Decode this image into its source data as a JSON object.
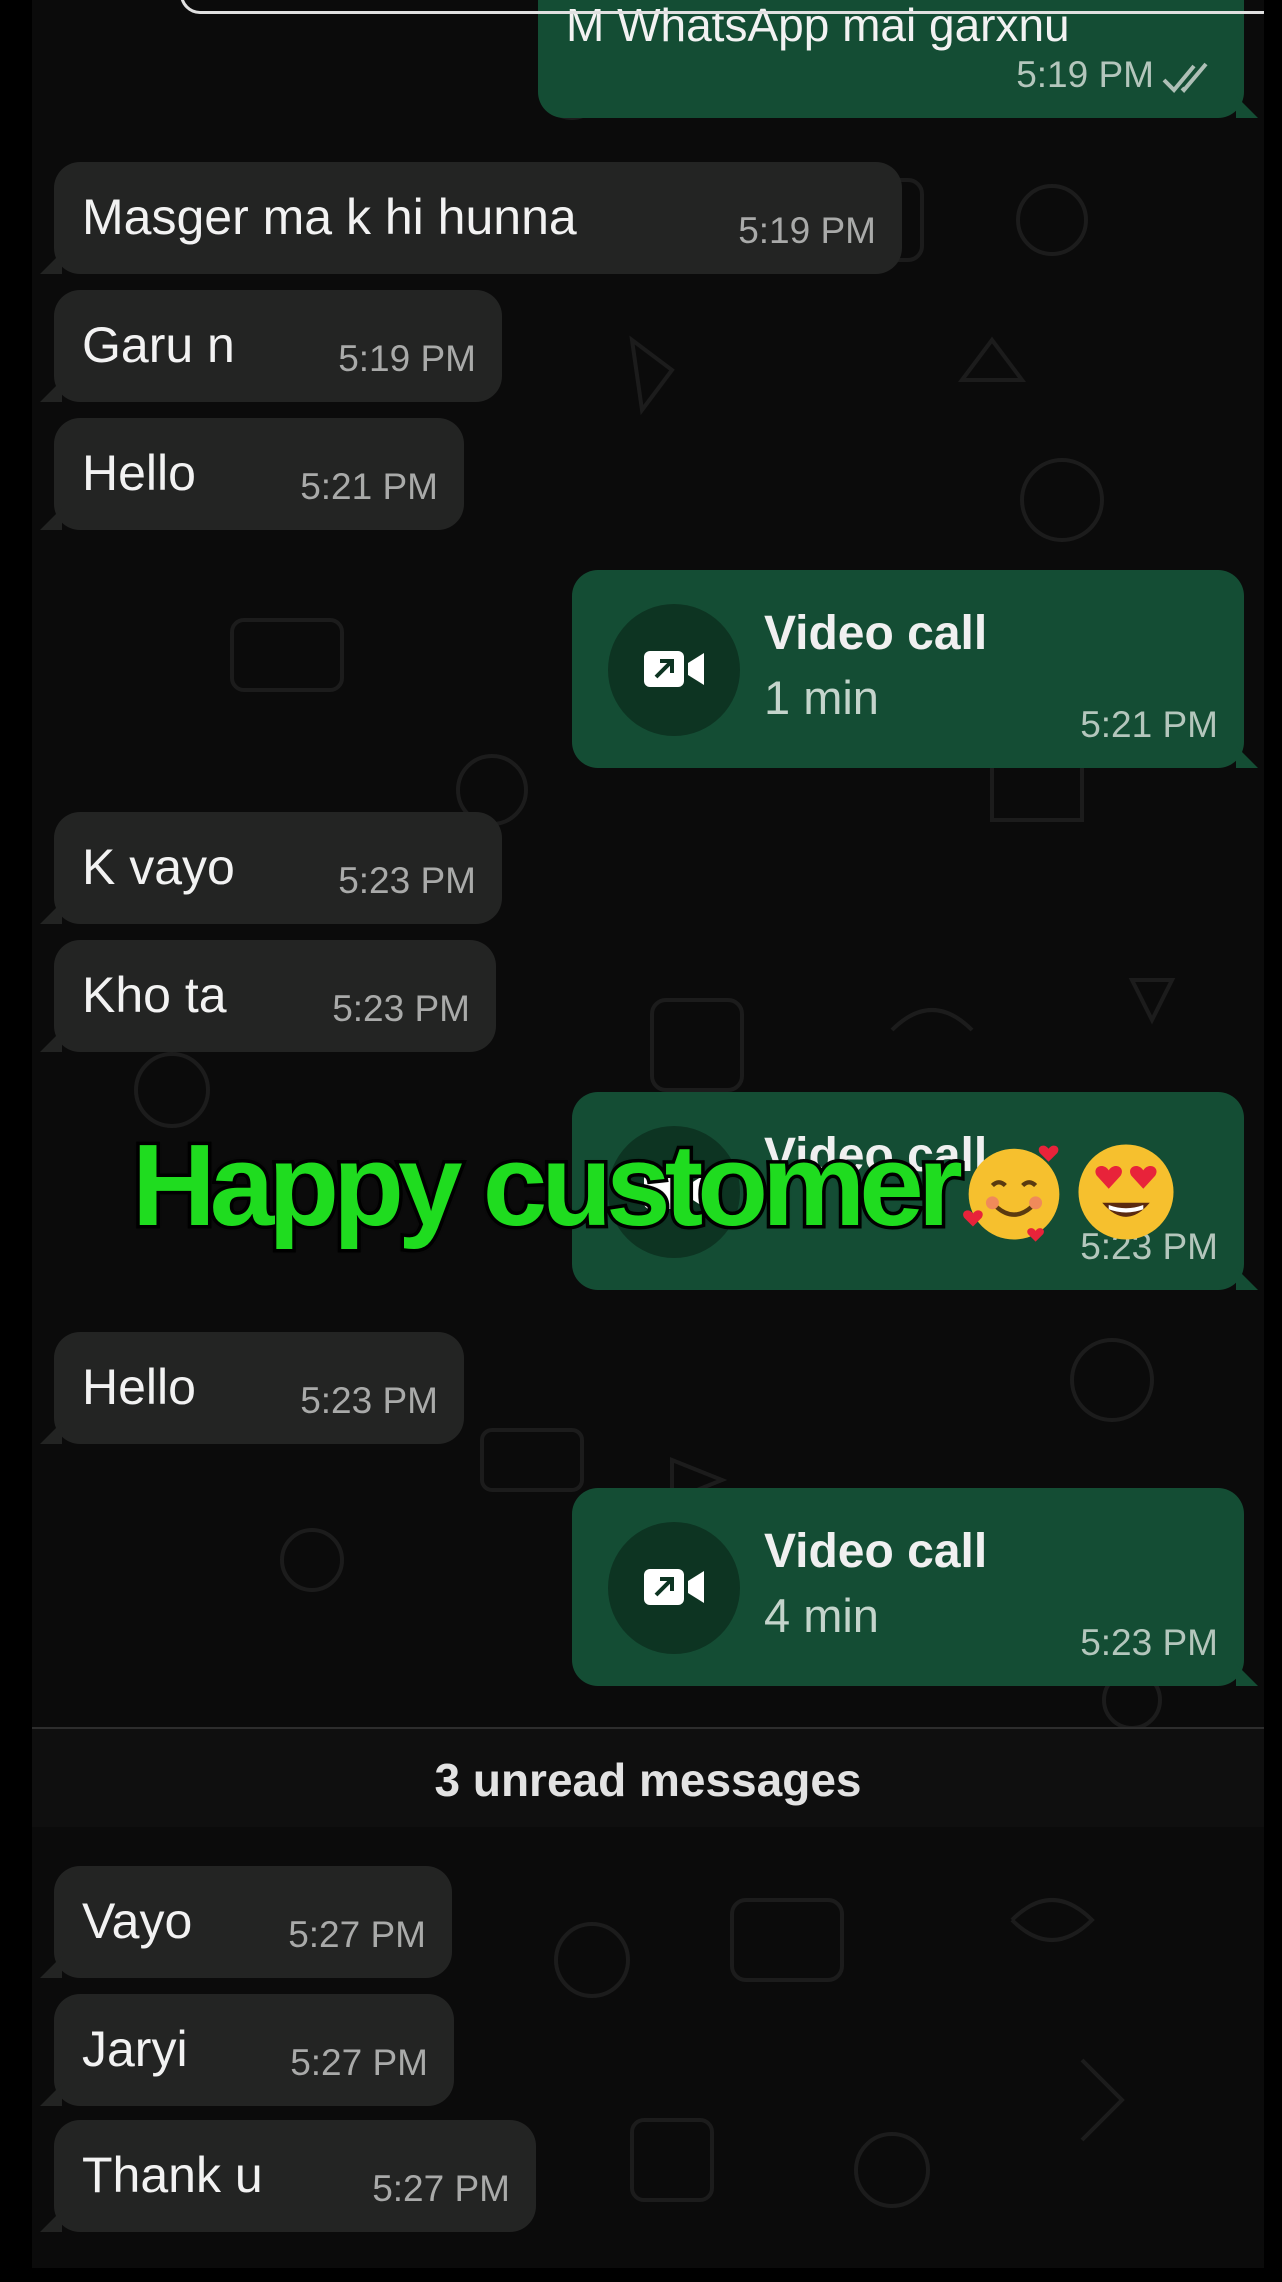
{
  "messages": [
    {
      "dir": "out",
      "text": "M WhatsApp mai garxnu",
      "time": "5:19 PM",
      "status": "read-double-check"
    },
    {
      "dir": "in",
      "text": "Masger ma k hi hunna",
      "time": "5:19 PM"
    },
    {
      "dir": "in",
      "text": "Garu n",
      "time": "5:19 PM"
    },
    {
      "dir": "in",
      "text": "Hello",
      "time": "5:21 PM"
    },
    {
      "dir": "out",
      "type": "video-call",
      "title": "Video call",
      "duration": "1 min",
      "time": "5:21 PM"
    },
    {
      "dir": "in",
      "text": "K vayo",
      "time": "5:23 PM"
    },
    {
      "dir": "in",
      "text": "Kho ta",
      "time": "5:23 PM"
    },
    {
      "dir": "out",
      "type": "video-call",
      "title": "Video call",
      "duration": "",
      "time": "5:23 PM"
    },
    {
      "dir": "in",
      "text": "Hello",
      "time": "5:23 PM"
    },
    {
      "dir": "out",
      "type": "video-call",
      "title": "Video call",
      "duration": "4 min",
      "time": "5:23 PM"
    },
    {
      "dir": "in",
      "text": "Vayo",
      "time": "5:27 PM"
    },
    {
      "dir": "in",
      "text": "Jaryi",
      "time": "5:27 PM"
    },
    {
      "dir": "in",
      "text": "Thank u",
      "time": "5:27 PM"
    }
  ],
  "unread_divider": "3 unread messages",
  "overlay": {
    "caption": "Happy customer",
    "emojis": [
      "smiling-face-with-hearts",
      "heart-eyes"
    ]
  },
  "icons": {
    "call": "video-call-outgoing-icon",
    "ticks": "double-check-icon"
  },
  "colors": {
    "background": "#0b0b0b",
    "incoming_bubble": "#232423",
    "outgoing_bubble": "#144d34",
    "caption_green": "#1fdc1f"
  }
}
